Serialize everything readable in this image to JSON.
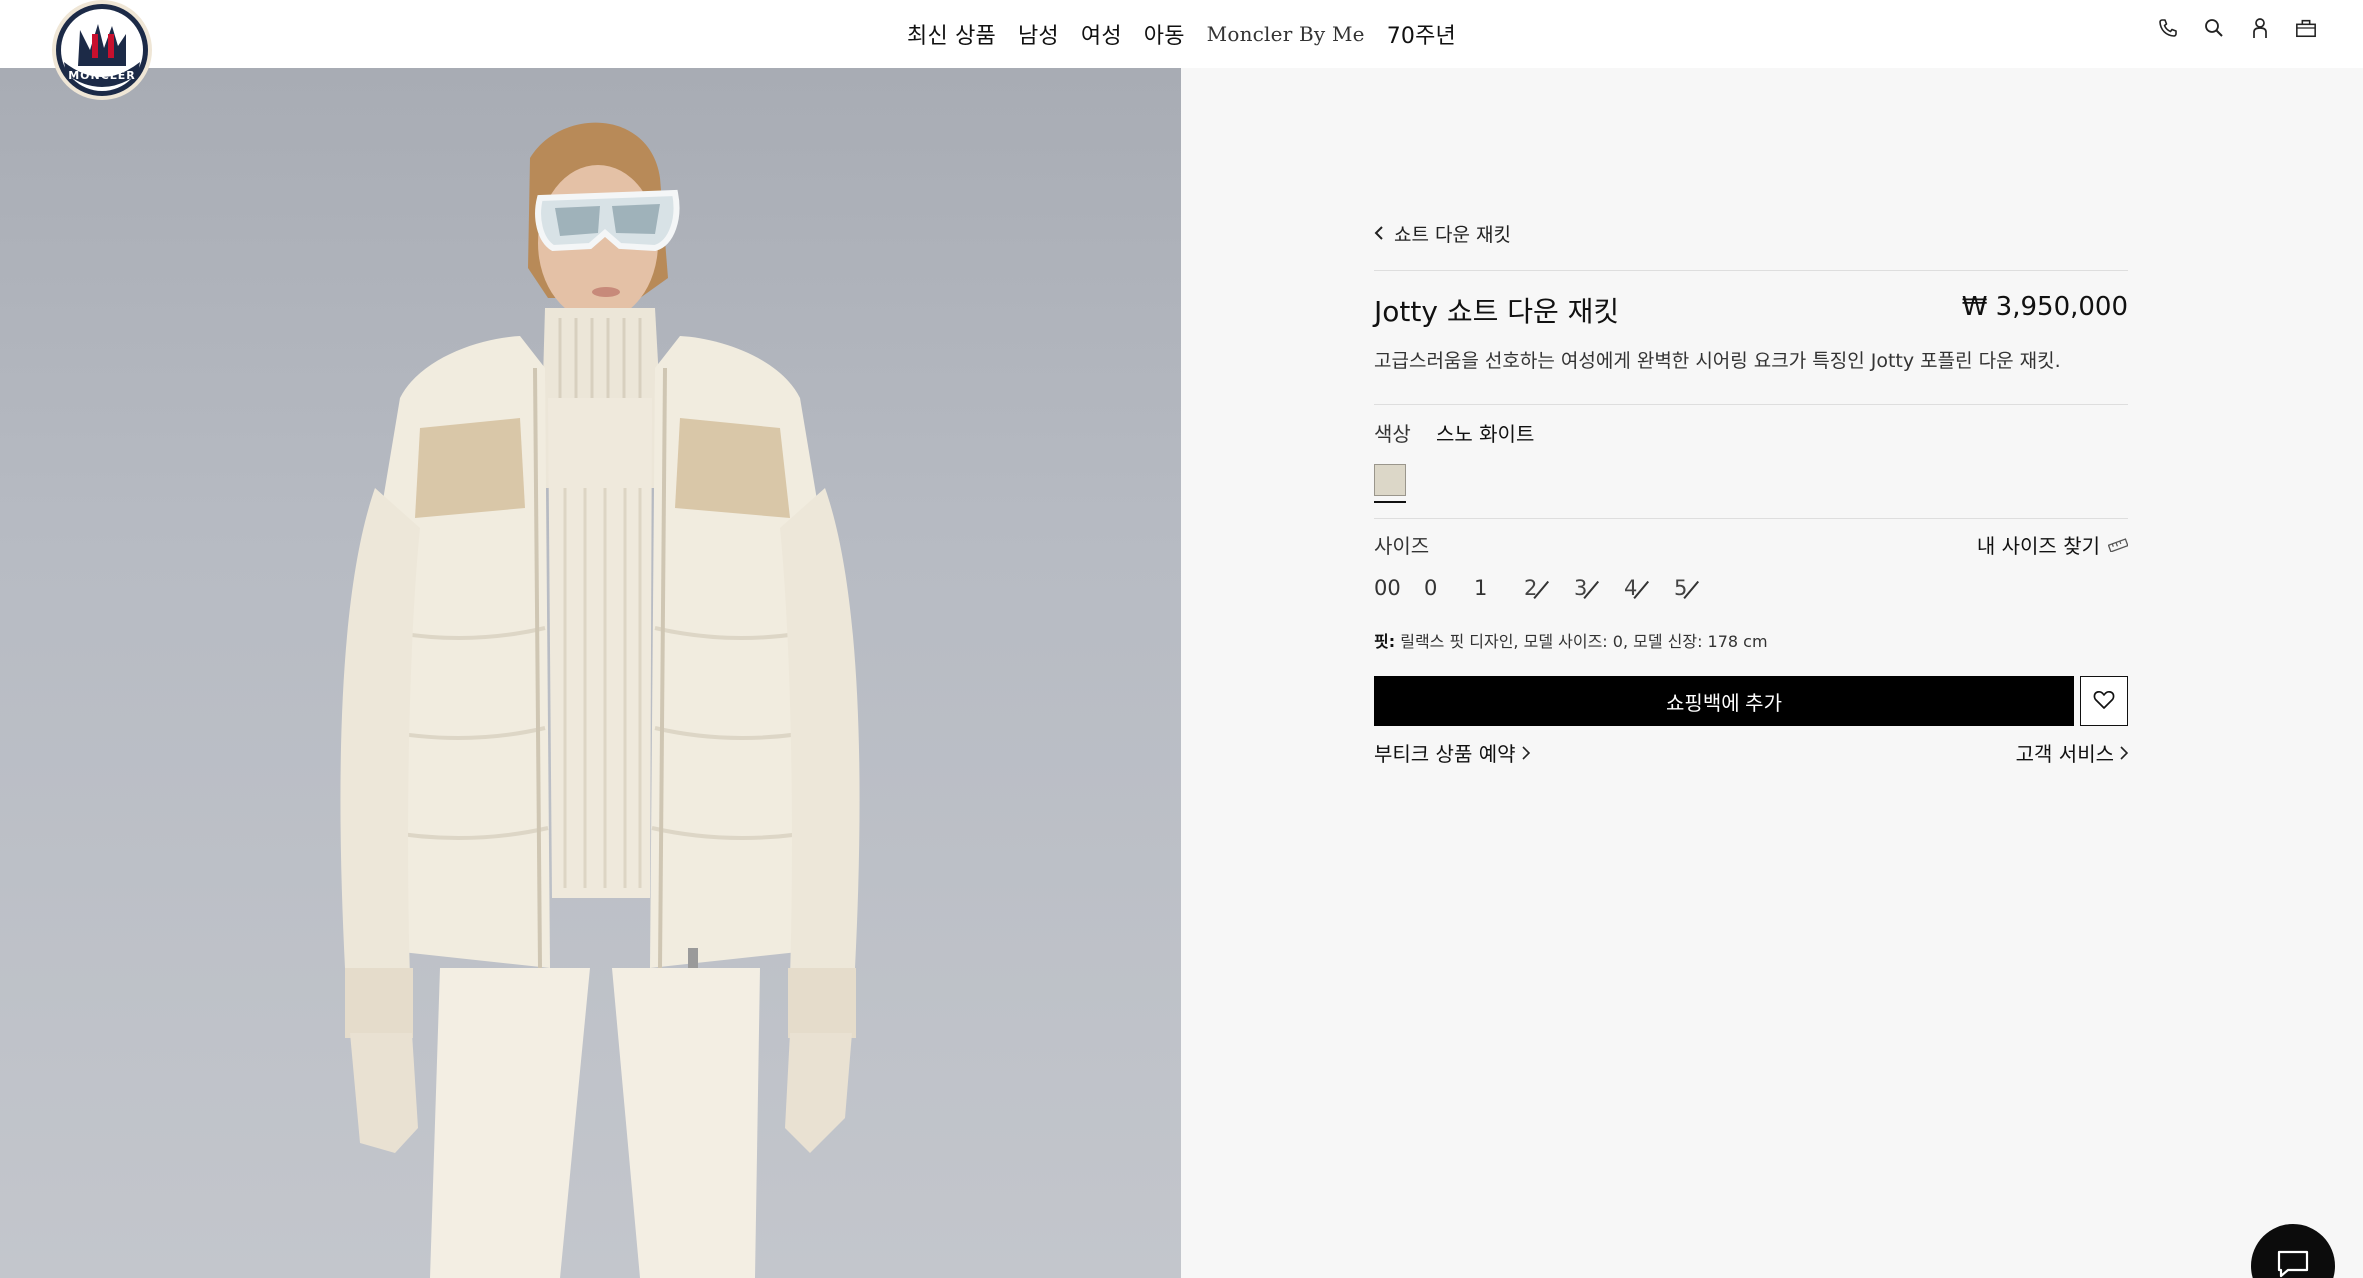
{
  "header": {
    "brand": "MONCLER",
    "nav": [
      "최신 상품",
      "남성",
      "여성",
      "아동",
      "Moncler By Me",
      "70주년"
    ],
    "icons": [
      "phone-icon",
      "search-icon",
      "account-icon",
      "shopping-bag-icon"
    ]
  },
  "product": {
    "back_label": "쇼트 다운 재킷",
    "name": "Jotty 쇼트 다운 재킷",
    "price": "₩ 3,950,000",
    "description": "고급스러움을 선호하는 여성에게 완벽한 시어링 요크가 특징인 Jotty 포플린 다운 재킷.",
    "color_label": "색상",
    "color_value": "스노 화이트",
    "swatch_color": "#dcd7c8",
    "size_label": "사이즈",
    "size_guide_label": "내 사이즈 찾기",
    "sizes": [
      {
        "label": "00",
        "available": true
      },
      {
        "label": "0",
        "available": true
      },
      {
        "label": "1",
        "available": true
      },
      {
        "label": "2",
        "available": false
      },
      {
        "label": "3",
        "available": false
      },
      {
        "label": "4",
        "available": false
      },
      {
        "label": "5",
        "available": false
      }
    ],
    "fit_label": "핏:",
    "fit_text": "릴랙스 핏 디자인, 모델 사이즈: 0, 모델 신장: 178 cm",
    "add_to_bag_label": "쇼핑백에 추가",
    "boutique_link": "부티크 상품 예약",
    "customer_service_link": "고객 서비스"
  },
  "colors": {
    "panel_bg": "#f7f7f7",
    "button_bg": "#000000",
    "divider": "#dedede"
  }
}
